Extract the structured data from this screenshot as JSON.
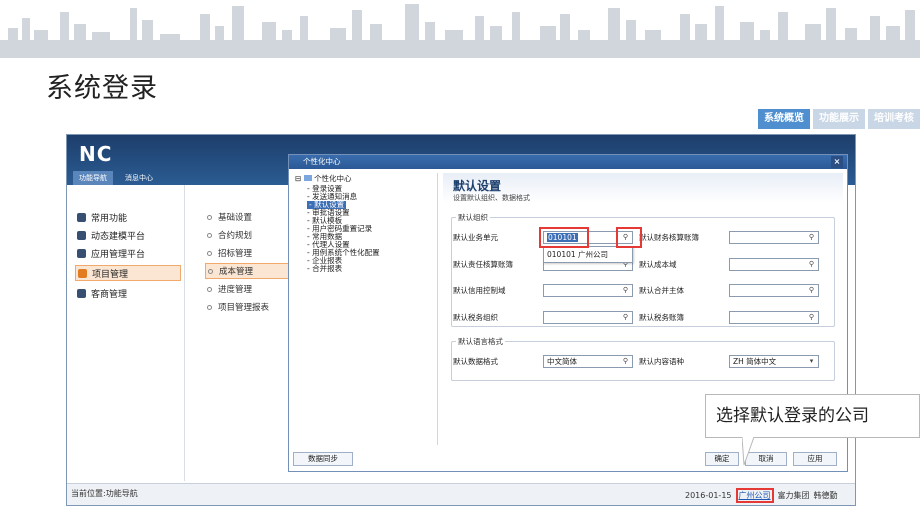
{
  "slide": {
    "title": "系统登录",
    "tabs": [
      {
        "label": "系统概览",
        "active": true
      },
      {
        "label": "功能展示",
        "active": false
      },
      {
        "label": "培训考核",
        "active": false
      }
    ],
    "callout": "选择默认登录的公司"
  },
  "app": {
    "logo": "NC",
    "nav_tabs": [
      "功能导航",
      "消息中心"
    ],
    "left_nav": [
      "常用功能",
      "动态建模平台",
      "应用管理平台",
      "项目管理",
      "客商管理"
    ],
    "sub_nav": [
      "基础设置",
      "合约规划",
      "招标管理",
      "成本管理",
      "进度管理",
      "项目管理报表"
    ],
    "status": {
      "location": "当前位置:功能导航",
      "date": "2016-01-15",
      "company": "广州公司",
      "group": "富力集团",
      "user": "韩德勤"
    },
    "colors": {
      "accent": "#e37b21",
      "header": "#1d3e6b",
      "highlight": "#e53935"
    }
  },
  "dialog": {
    "title": "个性化中心",
    "close": "×",
    "tree": {
      "root": "个性化中心",
      "children": [
        "登录设置",
        "发送通知消息",
        "默认设置",
        "审批语设置",
        "默认模板",
        "用户密码重置记录",
        "常用数据",
        "代理人设置",
        "用例系统个性化配置",
        "企业报表",
        "合并报表"
      ]
    },
    "sync_button": "数据同步",
    "panel": {
      "title": "默认设置",
      "subtitle": "设置默认组织、数据格式",
      "org_group": "默认组织",
      "fields_left": [
        "默认业务单元",
        "默认责任核算账簿",
        "默认信用控制域",
        "默认税务组织"
      ],
      "fields_right": [
        "默认财务核算账簿",
        "默认成本域",
        "默认合并主体",
        "默认税务账簿"
      ],
      "business_unit_value": "010101",
      "dropdown_option": "010101 广州公司",
      "lang_group": "默认语言格式",
      "data_format_label": "默认数据格式",
      "data_format_value": "中文简体",
      "content_lang_label": "默认内容语种",
      "content_lang_value": "ZH 简体中文"
    },
    "buttons": {
      "ok": "确定",
      "cancel": "取消",
      "apply": "应用"
    }
  }
}
